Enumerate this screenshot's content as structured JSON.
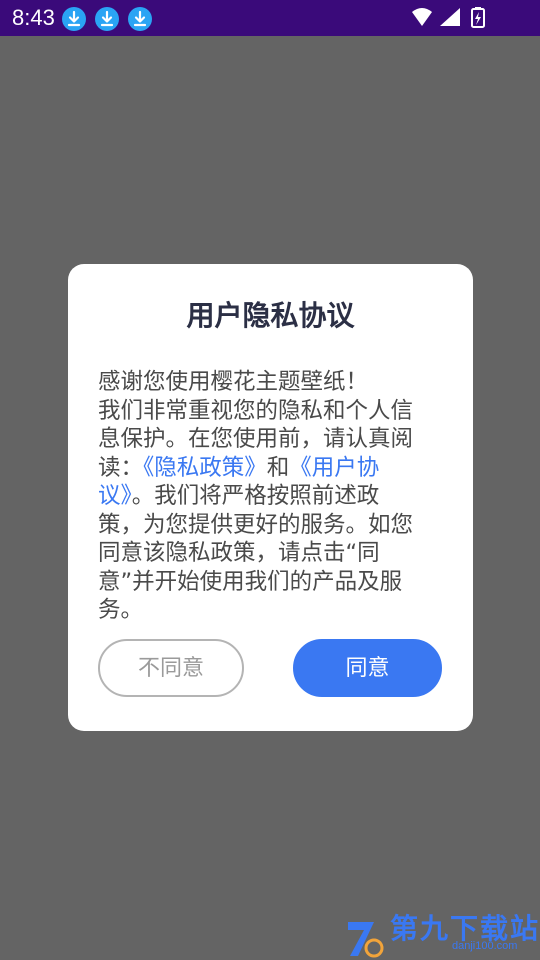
{
  "status_bar": {
    "time": "8:43",
    "icons": [
      "download-icon",
      "download-icon",
      "download-icon"
    ],
    "system_icons": [
      "wifi-icon",
      "signal-icon",
      "battery-icon"
    ]
  },
  "dialog": {
    "title": "用户隐私协议",
    "body": {
      "line1": "感谢您使用樱花主题壁纸！",
      "part1": "我们非常重视您的隐私和个人信息保护。在您使用前，请认真阅读：",
      "link_privacy": "《隐私政策》",
      "part2": "和",
      "link_agreement": "《用户协议》",
      "part3": "。我们将严格按照前述政策，为您提供更好的服务。如您同意该隐私政策，请点击“同意”并开始使用我们的产品及服务。"
    },
    "buttons": {
      "disagree": "不同意",
      "agree": "同意"
    }
  },
  "watermark": {
    "text": "第九下载站",
    "url": "danji100.com"
  },
  "colors": {
    "status_bar": "#3a0a7a",
    "overlay": "#646464",
    "accent": "#3a78f2",
    "title": "#2b2f45"
  }
}
